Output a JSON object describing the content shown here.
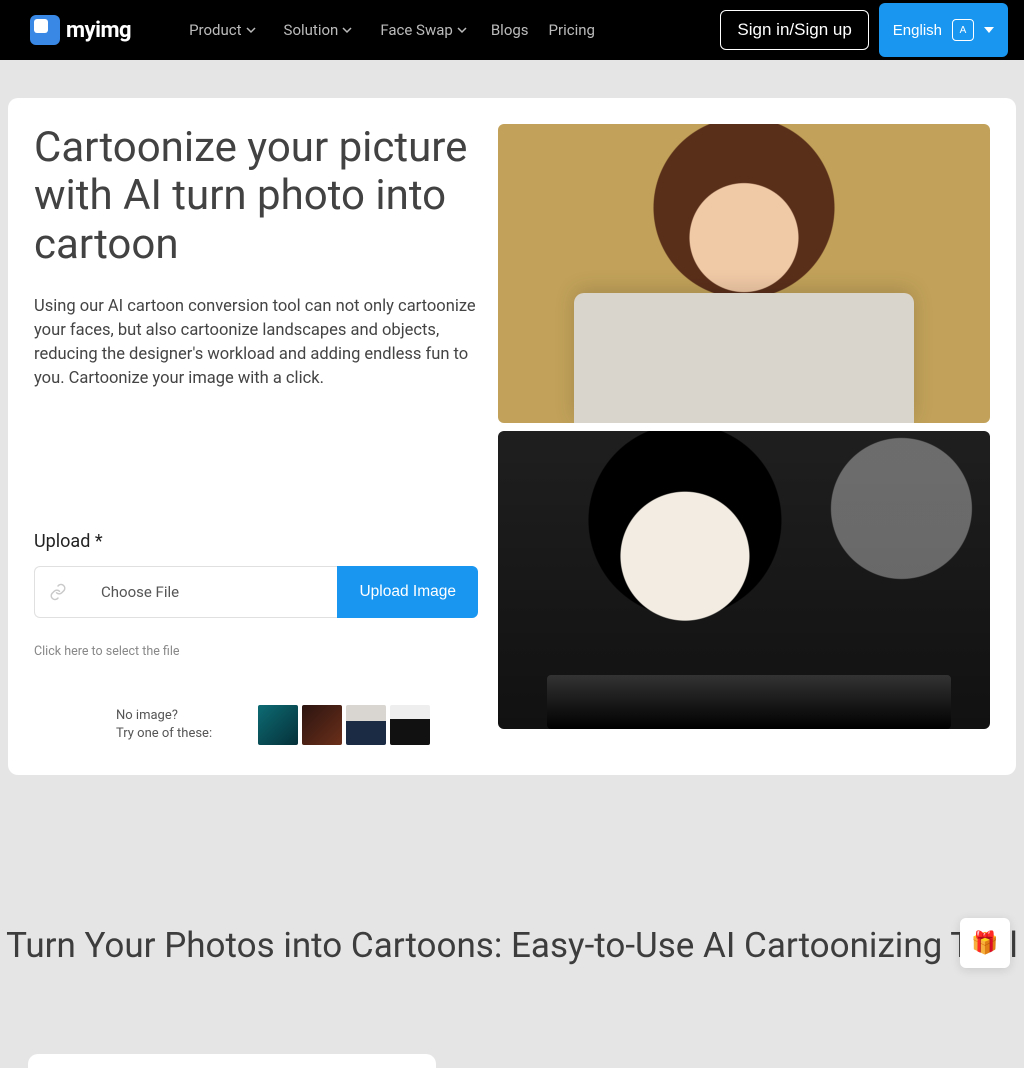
{
  "brand": "myimg",
  "nav": {
    "product": "Product",
    "solution": "Solution",
    "faceswap": "Face Swap",
    "blogs": "Blogs",
    "pricing": "Pricing"
  },
  "auth": {
    "signin": "Sign in/Sign up"
  },
  "lang": {
    "label": "English"
  },
  "hero": {
    "title": "Cartoonize your picture with AI turn photo into cartoon",
    "desc": "Using our AI cartoon conversion tool can not only cartoonize your faces, but also cartoonize landscapes and objects, reducing the designer's workload and adding endless fun to you. Cartoonize your image with a click."
  },
  "upload": {
    "label": "Upload *",
    "choose": "Choose File",
    "button": "Upload Image",
    "hint": "Click here to select the file"
  },
  "samples": {
    "line1": "No image?",
    "line2": "Try one of these:"
  },
  "section2": {
    "title": "Turn Your Photos into Cartoons: Easy-to-Use AI Cartoonizing Tool"
  },
  "gift": {
    "emoji": "🎁"
  }
}
